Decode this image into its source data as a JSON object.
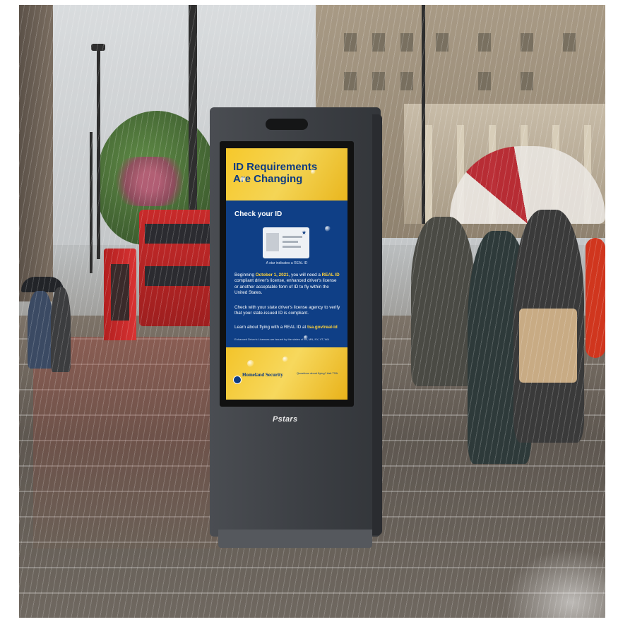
{
  "kiosk": {
    "brand": "Pstars",
    "screen": {
      "title_line1": "ID Requirements",
      "title_line2": "Are Changing",
      "heading": "Check your ID",
      "card_caption": "A star indicates a REAL ID",
      "para1_pre": "Beginning ",
      "para1_date": "October 1, 2021",
      "para1_mid": ", you will need a ",
      "para1_realid": "REAL ID",
      "para1_post": " compliant driver's license, enhanced driver's license or another acceptable form of ID to fly within the United States.",
      "para2": "Check with your state driver's license agency to verify that your state-issued ID is compliant.",
      "para3_pre": "Learn about flying with a REAL ID at ",
      "para3_link": "tsa.gov/real-id",
      "fine_print": "Enhanced Driver's Licenses are issued by the states of MI, MN, NY, VT, WA",
      "footer_org": "Homeland Security",
      "footer_question": "Questions about flying? Ask TSA"
    }
  },
  "colors": {
    "screen_blue": "#0f3f86",
    "screen_yellow": "#f7c82a",
    "kiosk_body": "#3b3e43"
  }
}
